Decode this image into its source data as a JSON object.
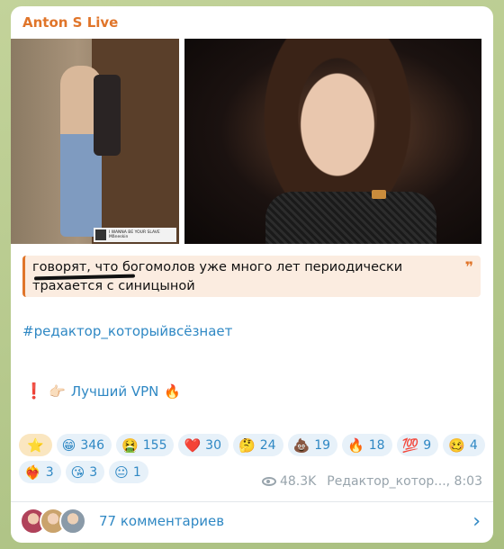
{
  "post": {
    "channel_name": "Anton S Live",
    "sticker_title": "I WANNA BE YOUR SLAVE",
    "sticker_artist": "Måneskin",
    "quote_text": "говорят, что богомолов уже много лет периодически трахается с синицыной",
    "quote_mark": "❞",
    "hashtag": "#редактор_которыйвсёзнает",
    "vpn_excl": "❗",
    "vpn_point": "👉🏻",
    "vpn_link": "Лучший VPN",
    "vpn_fire": "🔥",
    "views": "48.3K",
    "author_time": "Редактор_котор..., 8:03",
    "comments_label": "77 комментариев",
    "chevron": "›"
  },
  "reactions": [
    {
      "emoji": "⭐",
      "count": ""
    },
    {
      "emoji": "😁",
      "count": "346"
    },
    {
      "emoji": "🤮",
      "count": "155"
    },
    {
      "emoji": "❤️",
      "count": "30"
    },
    {
      "emoji": "🤔",
      "count": "24"
    },
    {
      "emoji": "💩",
      "count": "19"
    },
    {
      "emoji": "🔥",
      "count": "18"
    },
    {
      "emoji": "💯",
      "count": "9"
    },
    {
      "emoji": "🥴",
      "count": "4"
    },
    {
      "emoji": "❤️‍🔥",
      "count": "3"
    },
    {
      "emoji": "😘",
      "count": "3"
    },
    {
      "emoji": "😐",
      "count": "1"
    }
  ],
  "colors": {
    "accent_orange": "#e0752a",
    "link_blue": "#2f88c4",
    "reaction_bg": "#e7f1f9",
    "quote_bg": "#fbece0"
  }
}
